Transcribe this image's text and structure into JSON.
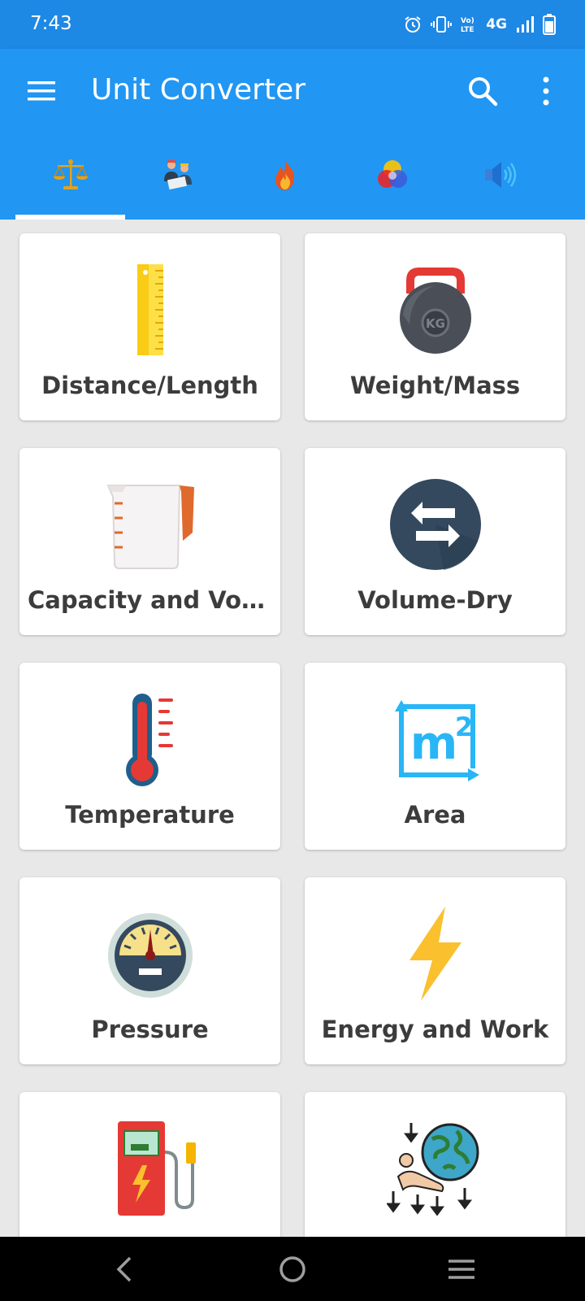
{
  "status_bar": {
    "time": "7:43",
    "network": "4G",
    "icons": [
      "alarm-icon",
      "vibrate-icon",
      "volte-icon",
      "signal-icon",
      "battery-icon"
    ]
  },
  "app_bar": {
    "title": "Unit Converter",
    "icons": [
      "hamburger-menu-icon",
      "search-icon",
      "more-vert-icon"
    ]
  },
  "tabs": [
    {
      "icon": "scales-icon",
      "selected": true
    },
    {
      "icon": "engineers-icon",
      "selected": false
    },
    {
      "icon": "fire-icon",
      "selected": false
    },
    {
      "icon": "color-wheel-icon",
      "selected": false
    },
    {
      "icon": "speaker-icon",
      "selected": false
    }
  ],
  "categories": [
    {
      "label": "Distance/Length",
      "icon": "ruler-icon"
    },
    {
      "label": "Weight/Mass",
      "icon": "kettlebell-icon"
    },
    {
      "label": "Capacity and Volu…",
      "icon": "measuring-jug-icon"
    },
    {
      "label": "Volume-Dry",
      "icon": "swap-arrows-icon"
    },
    {
      "label": "Temperature",
      "icon": "thermometer-icon"
    },
    {
      "label": "Area",
      "icon": "area-m2-icon"
    },
    {
      "label": "Pressure",
      "icon": "pressure-gauge-icon"
    },
    {
      "label": "Energy and Work",
      "icon": "lightning-icon"
    },
    {
      "label": "",
      "icon": "fuel-pump-icon"
    },
    {
      "label": "",
      "icon": "gravity-globe-icon"
    }
  ],
  "colors": {
    "status_bar": "#1e88e5",
    "app_bar": "#2196f3",
    "background": "#e8e8e8",
    "card_text": "#3c3c3c"
  }
}
